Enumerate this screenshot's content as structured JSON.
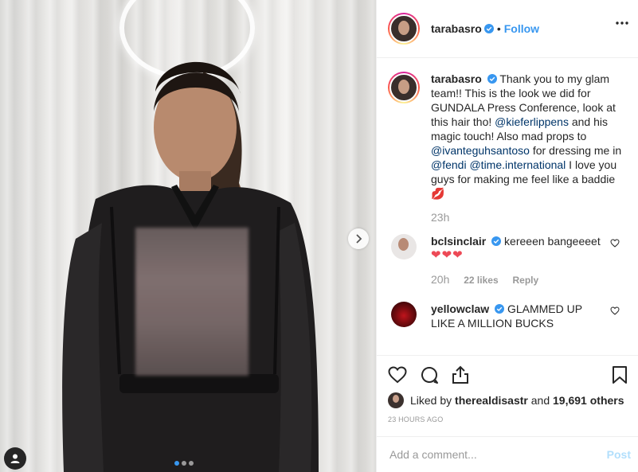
{
  "header": {
    "username": "tarabasro",
    "separator": "•",
    "follow_label": "Follow",
    "more_icon": "more-options-icon"
  },
  "caption": {
    "username": "tarabasro",
    "segments": [
      {
        "text": "Thank you to my glam team!! This is the look we did for GUNDALA Press Conference, look at this hair tho! ",
        "type": "text"
      },
      {
        "text": "@kieferlippens",
        "type": "mention"
      },
      {
        "text": " and his magic touch! Also mad props to ",
        "type": "text"
      },
      {
        "text": "@ivanteguhsantoso",
        "type": "mention"
      },
      {
        "text": " for dressing me in ",
        "type": "text"
      },
      {
        "text": "@fendi",
        "type": "mention"
      },
      {
        "text": " ",
        "type": "text"
      },
      {
        "text": "@time.international",
        "type": "mention"
      },
      {
        "text": " I love you guys for making me feel like a baddie ",
        "type": "text"
      },
      {
        "text": "💋",
        "type": "emoji"
      }
    ],
    "time": "23h"
  },
  "comments": [
    {
      "username": "bclsinclair",
      "text": "kereeen bangeeeet",
      "second_line": "❤❤❤",
      "time": "20h",
      "likes": "22 likes",
      "reply_label": "Reply"
    },
    {
      "username": "yellowclaw",
      "text": "GLAMMED UP LIKE A MILLION BUCKS"
    }
  ],
  "actions": {
    "liked_by_prefix": "Liked by",
    "liked_by_user": "therealdisastr",
    "and": "and",
    "others": "19,691 others",
    "time_ago": "23 HOURS AGO"
  },
  "add_comment": {
    "placeholder": "Add a comment...",
    "post_label": "Post"
  },
  "carousel": {
    "slide_count": 3,
    "active_index": 0
  },
  "colors": {
    "accent": "#3897f0",
    "mention": "#003569",
    "muted": "#999999",
    "like_red": "#ed4956",
    "post_disabled": "#b2dffc"
  }
}
